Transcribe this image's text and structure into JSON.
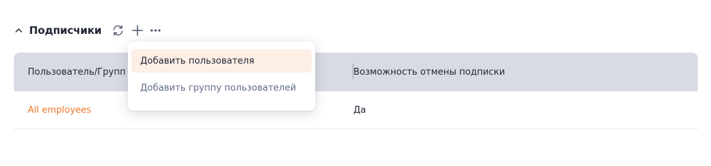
{
  "section": {
    "title": "Подписчики",
    "icons": {
      "collapse": "chevron-up-icon",
      "refresh": "refresh-icon",
      "add": "plus-icon",
      "more": "more-horizontal-icon"
    }
  },
  "table": {
    "columns": {
      "user": "Пользователь/Групп",
      "cancel": "Возможность отмены подписки"
    },
    "rows": [
      {
        "user": "All employees",
        "cancel": "Да"
      }
    ]
  },
  "dropdown": {
    "items": [
      {
        "label": "Добавить пользователя"
      },
      {
        "label": "Добавить группу пользователей"
      }
    ]
  },
  "colors": {
    "accent": "#f0762b",
    "header_bg": "#d8dbe3",
    "menu_highlight": "#fdefe6"
  }
}
